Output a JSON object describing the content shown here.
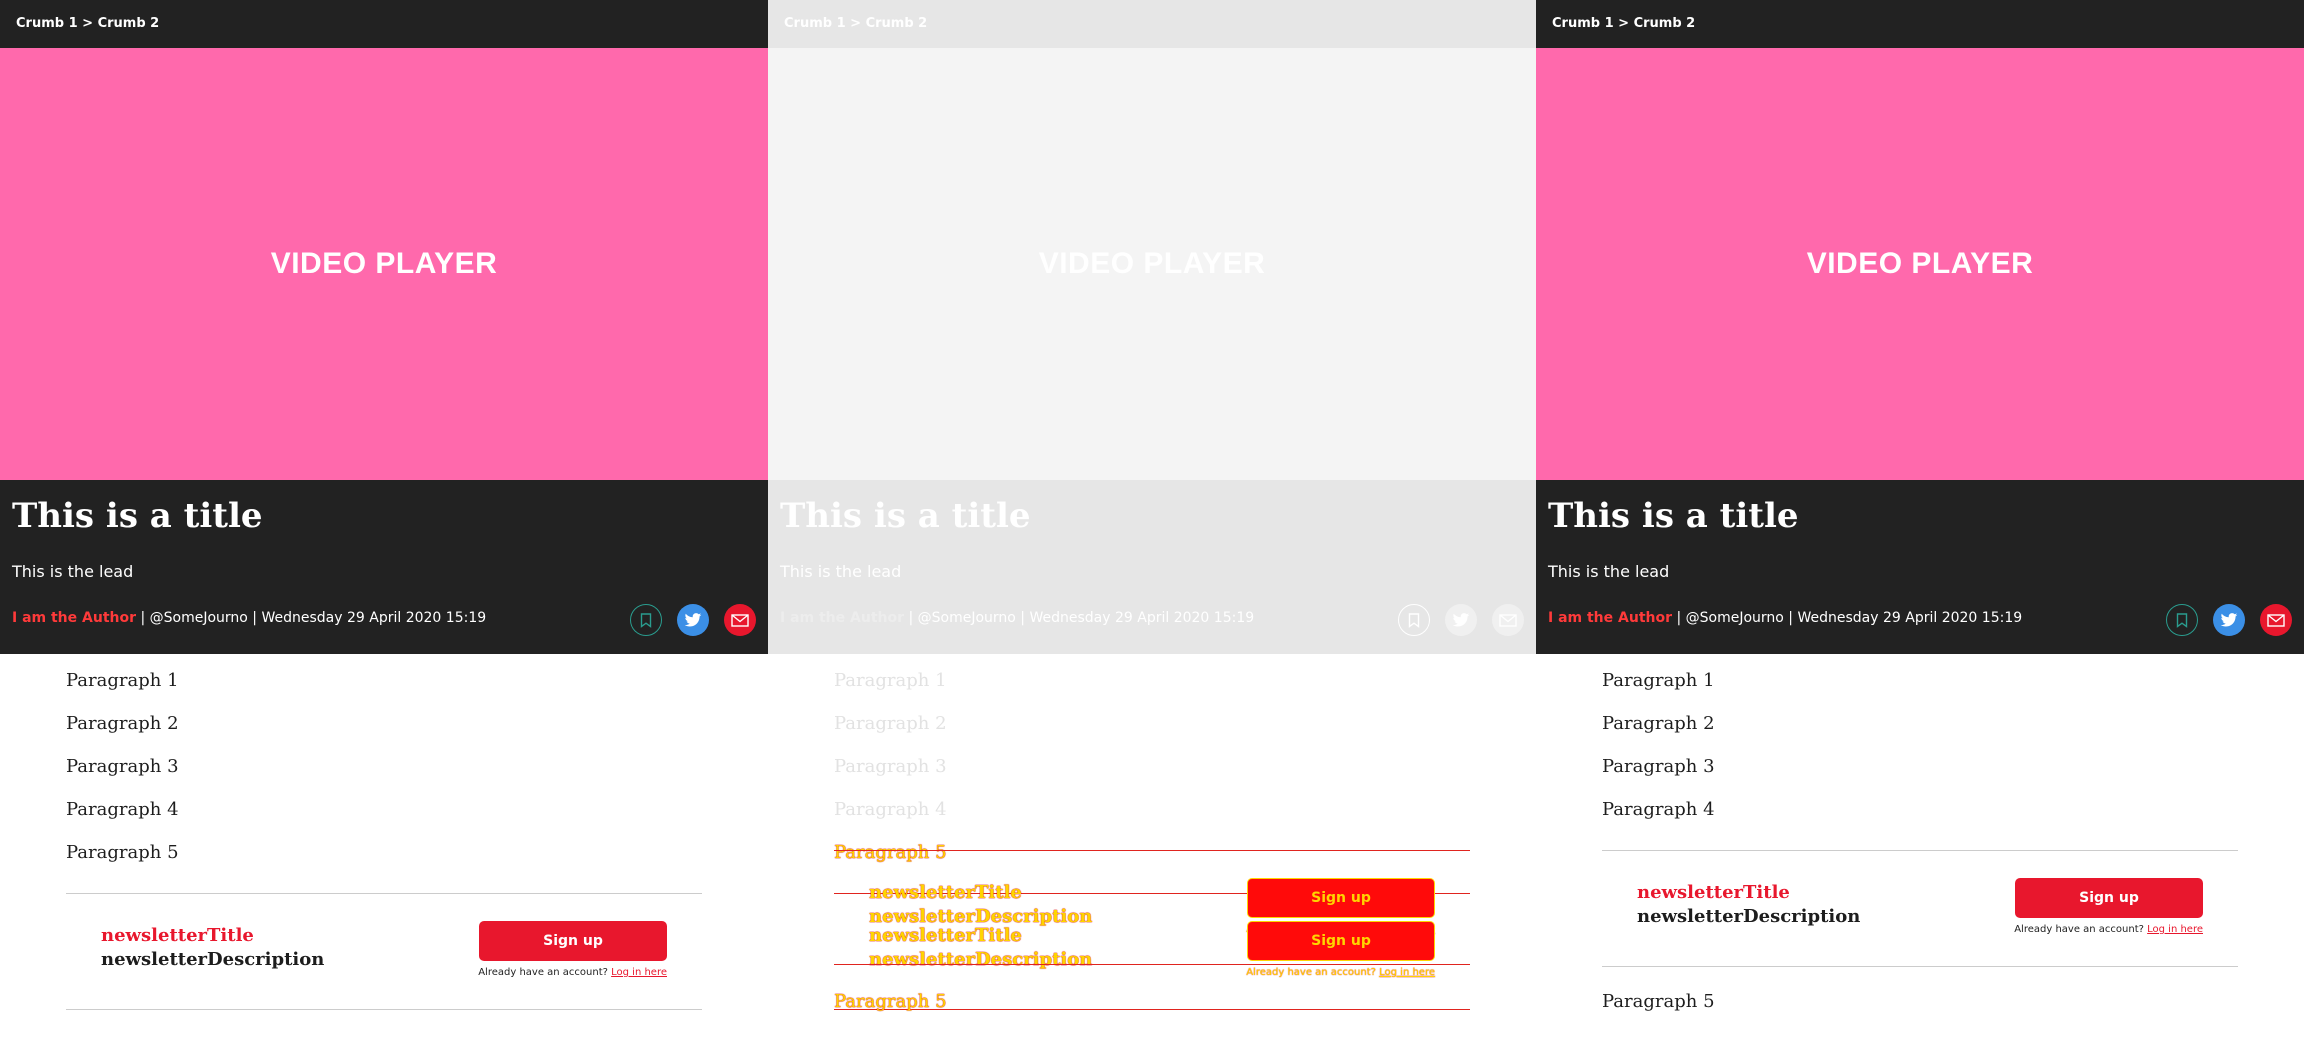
{
  "breadcrumb": {
    "text": "Crumb 1 > Crumb 2"
  },
  "video": {
    "label": "VIDEO PLAYER"
  },
  "article": {
    "title": "This is a title",
    "lead": "This is the lead",
    "author": "I am the Author",
    "handle": "@SomeJourno",
    "date": "Wednesday 29 April 2020 15:19",
    "byline_separator": " | "
  },
  "paragraphs": [
    "Paragraph 1",
    "Paragraph 2",
    "Paragraph 3",
    "Paragraph 4",
    "Paragraph 5"
  ],
  "newsletter": {
    "title": "newsletterTitle",
    "description": "newsletterDescription",
    "signup_label": "Sign up",
    "login_prompt": "Already have an account? ",
    "login_link": "Log in here"
  },
  "icons": {
    "save": "bookmark-icon",
    "twitter": "twitter-icon",
    "email": "email-icon"
  },
  "colors": {
    "dark_bar": "#222222",
    "video_bg": "#ff69ac",
    "author": "#ff3a3a",
    "brand_red": "#e8172d",
    "twitter_blue": "#3b8fe6",
    "save_outline": "#2a9d8f",
    "debug_outline": "#e0241f",
    "debug_text": "#ffd400"
  }
}
